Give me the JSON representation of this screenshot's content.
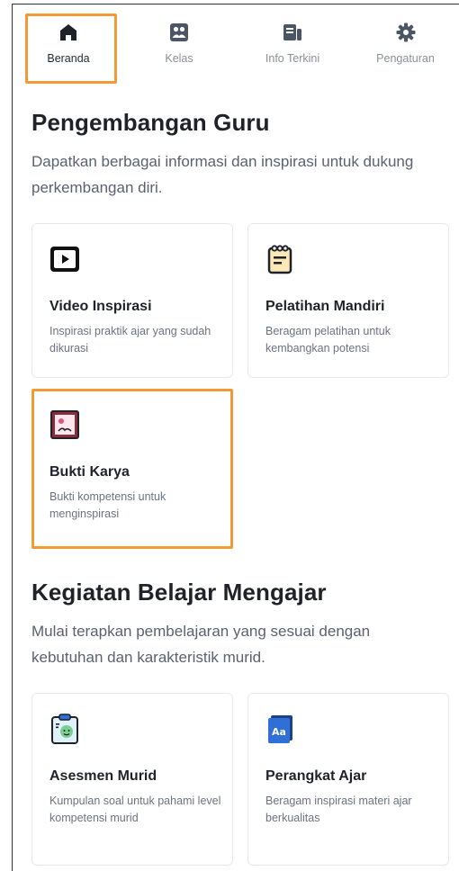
{
  "nav": {
    "items": [
      {
        "label": "Beranda",
        "icon": "home-icon",
        "active": true
      },
      {
        "label": "Kelas",
        "icon": "class-icon",
        "active": false
      },
      {
        "label": "Info Terkini",
        "icon": "news-icon",
        "active": false
      },
      {
        "label": "Pengaturan",
        "icon": "gear-icon",
        "active": false
      }
    ]
  },
  "section1": {
    "title": "Pengembangan Guru",
    "description": "Dapatkan berbagai informasi dan inspirasi untuk dukung perkembangan diri.",
    "cards": [
      {
        "title": "Video Inspirasi",
        "description": "Inspirasi praktik ajar yang sudah dikurasi",
        "icon": "video-play-icon"
      },
      {
        "title": "Pelatihan Mandiri",
        "description": "Beragam pelatihan untuk kembangkan potensi",
        "icon": "notepad-icon"
      },
      {
        "title": "Bukti Karya",
        "description": "Bukti kompetensi untuk menginspirasi",
        "icon": "certificate-frame-icon"
      }
    ]
  },
  "section2": {
    "title": "Kegiatan Belajar Mengajar",
    "description": "Mulai terapkan pembelajaran yang sesuai dengan kebutuhan dan karakteristik murid.",
    "cards": [
      {
        "title": "Asesmen Murid",
        "description": "Kumpulan soal untuk pahami level kompetensi murid",
        "icon": "clipboard-assessment-icon"
      },
      {
        "title": "Perangkat Ajar",
        "description": "Beragam inspirasi materi ajar berkualitas",
        "icon": "book-aa-icon"
      }
    ]
  },
  "colors": {
    "highlight": "#f29a35",
    "title": "#1f2329",
    "muted": "#6b7280"
  }
}
